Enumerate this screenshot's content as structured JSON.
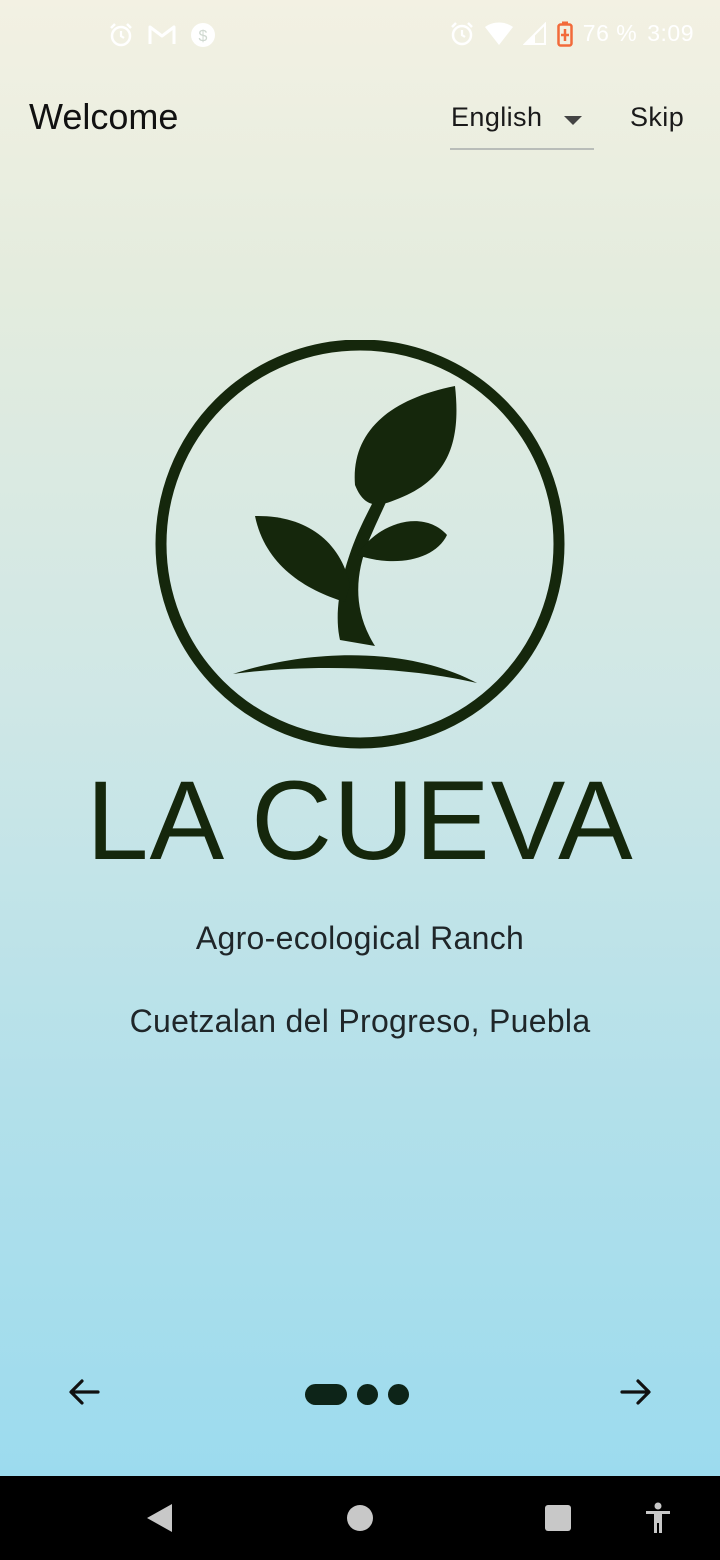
{
  "status_bar": {
    "left_icons": [
      "alarm-icon",
      "gmail-icon",
      "dollar-circle-icon"
    ],
    "right_icons": [
      "alarm-icon",
      "wifi-icon",
      "signal-icon",
      "battery-charging-icon"
    ],
    "battery": "76 %",
    "time": "3:09"
  },
  "header": {
    "title": "Welcome",
    "language": {
      "selected": "English"
    },
    "skip_label": "Skip"
  },
  "logo": {
    "icon": "sprout-in-circle-icon",
    "color": "#15270c"
  },
  "main": {
    "brand": "LA CUEVA",
    "subtitle": "Agro-ecological Ranch",
    "location": "Cuetzalan del Progreso, Puebla"
  },
  "pager": {
    "pages_total": 3,
    "current_page": 1,
    "prev_icon": "arrow-left-icon",
    "next_icon": "arrow-right-icon"
  },
  "system_nav": {
    "buttons": [
      "back-icon",
      "home-icon",
      "recents-icon",
      "accessibility-icon"
    ]
  }
}
